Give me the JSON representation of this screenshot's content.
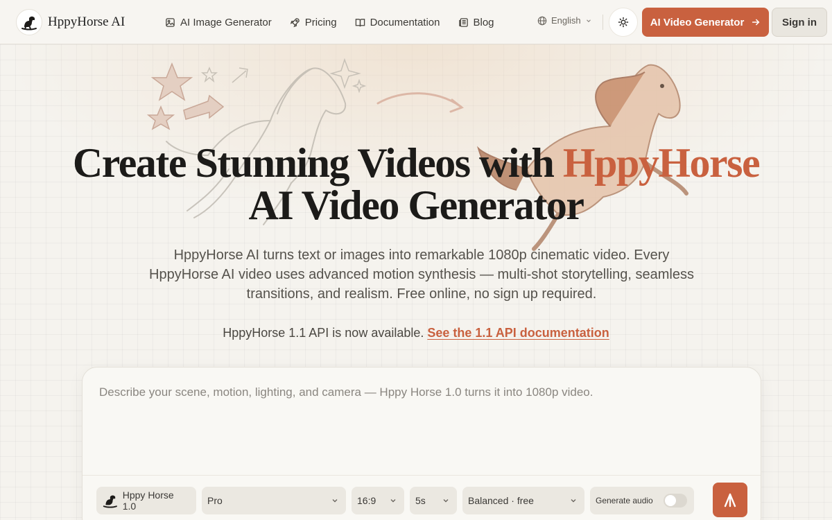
{
  "header": {
    "brand": "HppyHorse AI",
    "nav": [
      {
        "label": "AI Image Generator",
        "icon": "image-icon"
      },
      {
        "label": "Pricing",
        "icon": "rocket-icon"
      },
      {
        "label": "Documentation",
        "icon": "book-icon"
      },
      {
        "label": "Blog",
        "icon": "newspaper-icon"
      }
    ],
    "language": "English",
    "cta_label": "AI Video Generator",
    "signin_label": "Sign in"
  },
  "hero": {
    "title_line1_prefix": "Create Stunning Videos with ",
    "title_line1_accent": "HppyHorse",
    "title_line2": "AI Video Generator",
    "subtitle": "HppyHorse AI turns text or images into remarkable 1080p cinematic video. Every HppyHorse AI video uses advanced motion synthesis — multi‑shot storytelling, seamless transitions, and realism. Free online, no sign up required.",
    "api_text": "HppyHorse 1.1 API is now available.",
    "api_link": "See the 1.1 API documentation"
  },
  "composer": {
    "placeholder": "Describe your scene, motion, lighting, and camera — Hppy Horse 1.0 turns it into 1080p video.",
    "model": "Hppy Horse 1.0",
    "tier": "Pro",
    "aspect": "16:9",
    "duration": "5s",
    "mode": "Balanced · free",
    "audio_label": "Generate audio",
    "audio_enabled": false
  },
  "colors": {
    "accent": "#c9613f",
    "background": "#f5f3ee"
  }
}
